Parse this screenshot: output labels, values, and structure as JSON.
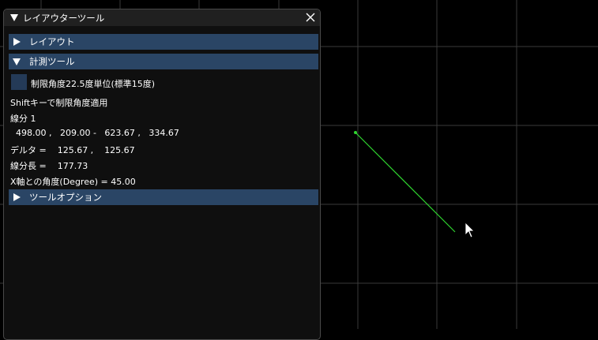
{
  "window": {
    "title": "レイアウターツール"
  },
  "sections": {
    "layout": {
      "label": "レイアウト",
      "expanded": false
    },
    "measure": {
      "label": "計測ツール",
      "expanded": true
    },
    "options": {
      "label": "ツールオプション",
      "expanded": false
    }
  },
  "measure": {
    "snap_checkbox_label": "制限角度22.5度単位(標準15度)",
    "snap_checked": false,
    "hint": "Shiftキーで制限角度適用",
    "segment_label": "線分 1",
    "coords": "  498.00 ,   209.00 -   623.67 ,   334.67",
    "delta": "デルタ =    125.67 ,    125.67",
    "length": "線分長 =    177.73",
    "angle": "X軸との角度(Degree) = 45.00"
  },
  "colors": {
    "background": "#000000",
    "grid": "#3a3a3a",
    "measure_line": "#2fd62f",
    "header": "#2a4565",
    "window_bg": "#0f0f0f"
  }
}
